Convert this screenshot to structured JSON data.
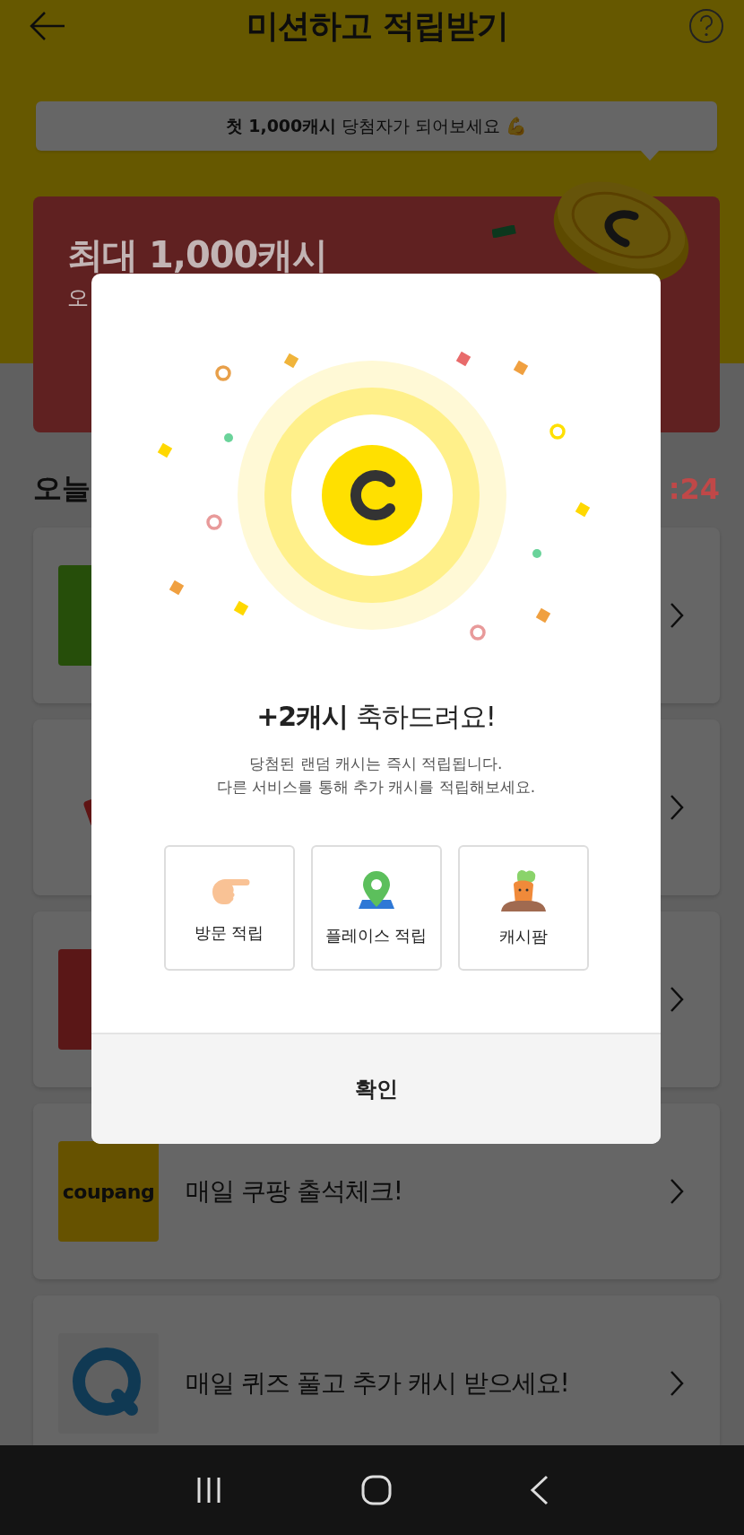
{
  "header": {
    "title": "미션하고 적립받기"
  },
  "promo_bubble": {
    "text": "**첫 1,000캐시** 당첨자가 되어보세요 💪"
  },
  "banner": {
    "title": "최대 1,000캐시",
    "subtitle": "오"
  },
  "section": {
    "title": "오늘",
    "timer": ":24"
  },
  "missions": [
    {
      "kind": "green"
    },
    {
      "kind": "tag"
    },
    {
      "kind": "red"
    },
    {
      "kind": "coupang",
      "logo_text": "coupang",
      "title": "매일 쿠팡 출석체크!"
    },
    {
      "kind": "quiz",
      "title": "매일 퀴즈 풀고 추가 캐시 받으세요!"
    }
  ],
  "dialog": {
    "title": "**+2캐시** 축하드려요!",
    "message_lines": [
      "당첨된 랜덤 캐시는 즉시 적립됩니다.",
      "다른 서비스를 통해 추가 캐시를 적립해보세요."
    ],
    "services": [
      {
        "kind": "visit",
        "label": "방문 적립"
      },
      {
        "kind": "place",
        "label": "플레이스 적립"
      },
      {
        "kind": "farm",
        "label": "캐시팜"
      }
    ],
    "confirm": "확인"
  }
}
